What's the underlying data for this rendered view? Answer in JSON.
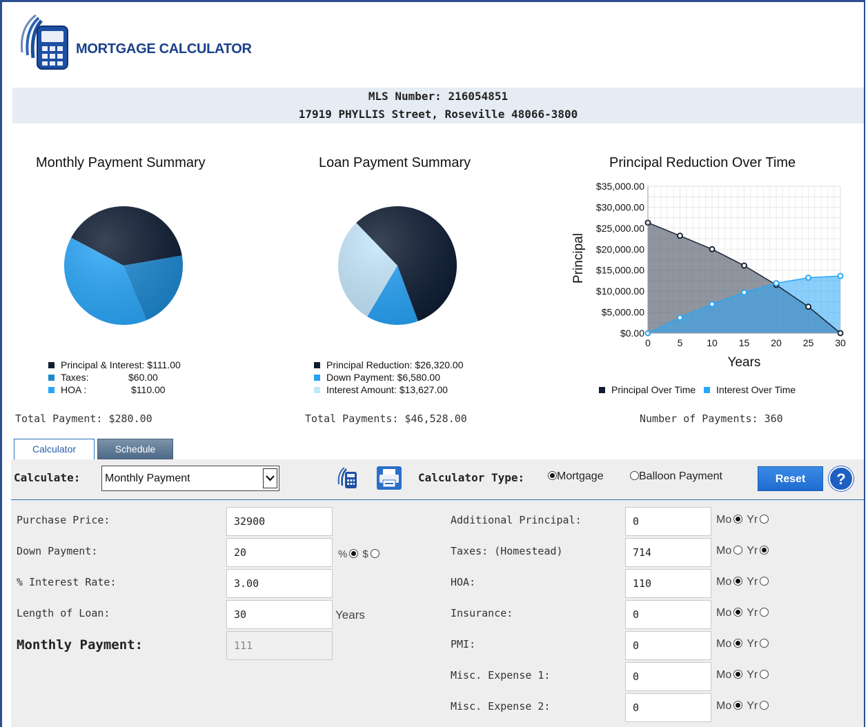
{
  "app": {
    "title": "MORTGAGE CALCULATOR"
  },
  "listing": {
    "mls": "MLS Number: 216054851",
    "address": "17919 PHYLLIS Street, Roseville 48066-3800"
  },
  "monthly_summary": {
    "title": "Monthly Payment Summary",
    "legend": [
      {
        "label": "Principal & Interest:",
        "value": "$111.00",
        "color": "#0f1d33"
      },
      {
        "label": "Taxes:",
        "value": "$60.00",
        "color": "#1e88d0"
      },
      {
        "label": "HOA :",
        "value": "$110.00",
        "color": "#2aa6f7"
      }
    ],
    "total": "Total Payment: $280.00"
  },
  "loan_summary": {
    "title": "Loan Payment Summary",
    "legend": [
      {
        "label": "Principal Reduction:",
        "value": "$26,320.00",
        "color": "#0f1d33"
      },
      {
        "label": "Down Payment:",
        "value": "$6,580.00",
        "color": "#27a2f5"
      },
      {
        "label": "Interest Amount:",
        "value": "$13,627.00",
        "color": "#c4e6fb"
      }
    ],
    "total": "Total Payments: $46,528.00"
  },
  "principal_reduction": {
    "title": "Principal Reduction Over Time",
    "legend": [
      {
        "label": "Principal Over Time",
        "color": "#0f1d33"
      },
      {
        "label": "Interest Over Time",
        "color": "#2aa6f7"
      }
    ],
    "total": "Number of Payments: 360"
  },
  "chart_data": [
    {
      "type": "pie",
      "title": "Monthly Payment Summary",
      "categories": [
        "Principal & Interest",
        "Taxes",
        "HOA"
      ],
      "values": [
        111,
        60,
        110
      ],
      "colors": [
        "#0f1d33",
        "#1e88d0",
        "#2aa6f7"
      ]
    },
    {
      "type": "pie",
      "title": "Loan Payment Summary",
      "categories": [
        "Principal Reduction",
        "Down Payment",
        "Interest Amount"
      ],
      "values": [
        26320,
        6580,
        13627
      ],
      "colors": [
        "#0f1d33",
        "#27a2f5",
        "#c4e6fb"
      ]
    },
    {
      "type": "area",
      "title": "Principal Reduction Over Time",
      "xlabel": "Years",
      "ylabel": "Principal",
      "x": [
        0,
        5,
        10,
        15,
        20,
        25,
        30
      ],
      "xticks": [
        "0",
        "5",
        "10",
        "15",
        "20",
        "25",
        "30"
      ],
      "yticks": [
        "$0.00",
        "$5,000.00",
        "$10,000.00",
        "$15,000.00",
        "$20,000.00",
        "$25,000.00",
        "$30,000.00",
        "$35,000.00"
      ],
      "ylim": [
        0,
        35000
      ],
      "grid": true,
      "legend_position": "bottom",
      "series": [
        {
          "name": "Principal Over Time",
          "values": [
            26320,
            23200,
            20000,
            16100,
            11500,
            6300,
            0
          ],
          "color": "#0f1d33"
        },
        {
          "name": "Interest Over Time",
          "values": [
            0,
            3700,
            6900,
            9700,
            11900,
            13200,
            13627
          ],
          "color": "#2aa6f7"
        }
      ]
    }
  ],
  "tabs": {
    "calculator": "Calculator",
    "schedule": "Schedule"
  },
  "toolbar": {
    "calculate_label": "Calculate:",
    "calculate_value": "Monthly Payment",
    "calc_type_label": "Calculator Type:",
    "mortgage": "Mortgage",
    "balloon": "Balloon Payment",
    "reset": "Reset",
    "help": "?"
  },
  "form": {
    "purchase_price": {
      "label": "Purchase Price:",
      "value": "32900"
    },
    "down_payment": {
      "label": "Down Payment:",
      "value": "20",
      "pct": "%",
      "dollar": "$"
    },
    "interest_rate": {
      "label": "% Interest Rate:",
      "value": "3.00"
    },
    "loan_length": {
      "label": "Length of Loan:",
      "value": "30",
      "unit": "Years"
    },
    "monthly_payment": {
      "label": "Monthly Payment:",
      "value": "111"
    },
    "additional_principal": {
      "label": "Additional Principal:",
      "value": "0"
    },
    "taxes": {
      "label": "Taxes: (Homestead)",
      "value": "714"
    },
    "hoa": {
      "label": "HOA:",
      "value": "110"
    },
    "insurance": {
      "label": "Insurance:",
      "value": "0"
    },
    "pmi": {
      "label": "PMI:",
      "value": "0"
    },
    "misc1": {
      "label": "Misc. Expense 1:",
      "value": "0"
    },
    "misc2": {
      "label": "Misc. Expense 2:",
      "value": "0"
    },
    "mo": "Mo",
    "yr": "Yr"
  }
}
